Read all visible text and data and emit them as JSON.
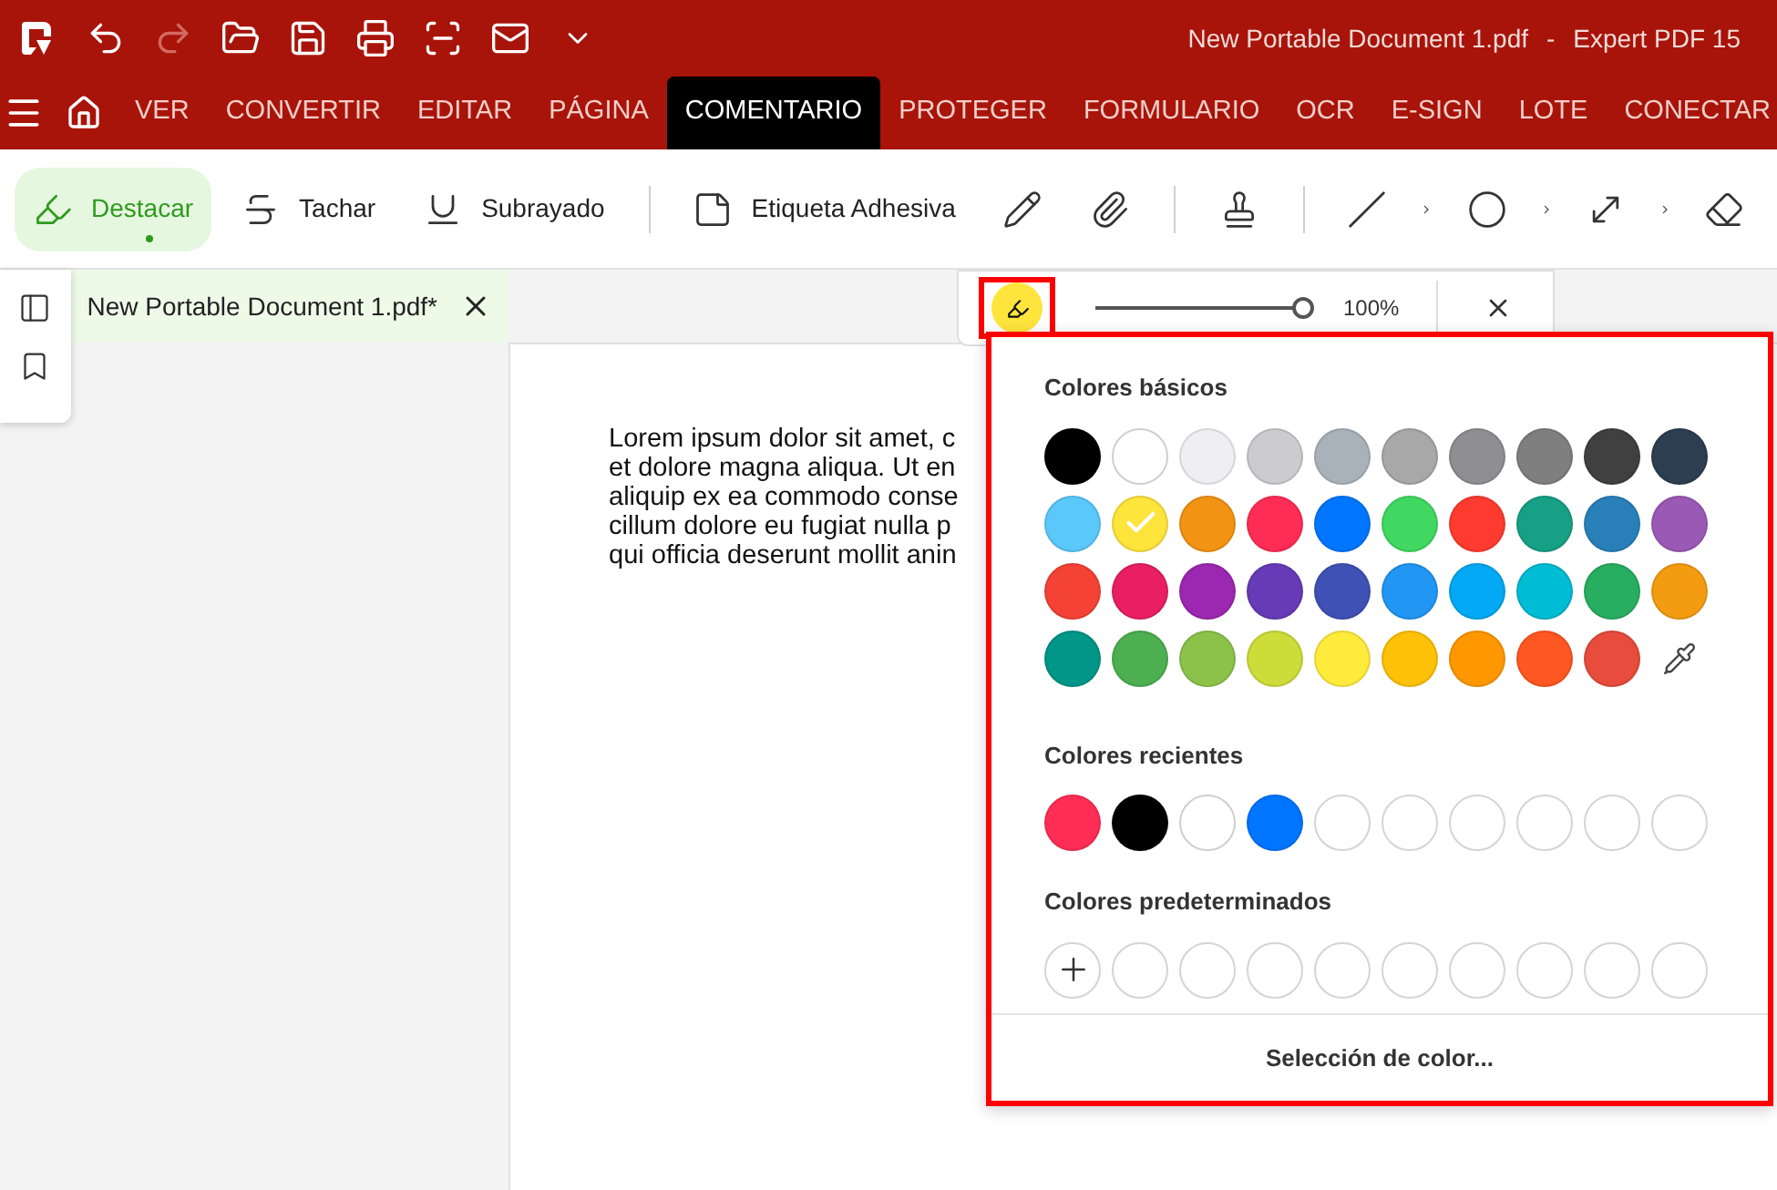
{
  "window": {
    "title": "New Portable Document 1.pdf",
    "separator": "-",
    "app_name": "Expert PDF 15"
  },
  "quick_access": [
    {
      "kind": "undo",
      "disabled": false
    },
    {
      "kind": "redo",
      "disabled": true
    },
    {
      "kind": "open",
      "disabled": false
    },
    {
      "kind": "save",
      "disabled": false
    },
    {
      "kind": "print",
      "disabled": false
    },
    {
      "kind": "scan",
      "disabled": false
    },
    {
      "kind": "mail",
      "disabled": false
    },
    {
      "kind": "more",
      "disabled": false
    }
  ],
  "menu_tabs": [
    {
      "label": "VER",
      "selected": false
    },
    {
      "label": "CONVERTIR",
      "selected": false
    },
    {
      "label": "EDITAR",
      "selected": false
    },
    {
      "label": "PÁGINA",
      "selected": false
    },
    {
      "label": "COMENTARIO",
      "selected": true
    },
    {
      "label": "PROTEGER",
      "selected": false
    },
    {
      "label": "FORMULARIO",
      "selected": false
    },
    {
      "label": "OCR",
      "selected": false
    },
    {
      "label": "E-SIGN",
      "selected": false
    },
    {
      "label": "LOTE",
      "selected": false
    },
    {
      "label": "CONECTAR",
      "selected": false
    }
  ],
  "toolbar": [
    {
      "kind": "highlight",
      "label": "Destacar",
      "selected": true
    },
    {
      "kind": "strike",
      "label": "Tachar",
      "selected": false
    },
    {
      "kind": "underline",
      "label": "Subrayado",
      "selected": false
    },
    {
      "kind": "divider"
    },
    {
      "kind": "note",
      "label": "Etiqueta Adhesiva",
      "selected": false
    },
    {
      "kind": "pencil",
      "selected": false
    },
    {
      "kind": "attach",
      "selected": false
    },
    {
      "kind": "divider"
    },
    {
      "kind": "stamp",
      "selected": false
    },
    {
      "kind": "divider"
    },
    {
      "kind": "line",
      "selected": false
    },
    {
      "kind": "chevron"
    },
    {
      "kind": "ellipse",
      "selected": false
    },
    {
      "kind": "chevron"
    },
    {
      "kind": "measure",
      "selected": false
    },
    {
      "kind": "chevron"
    },
    {
      "kind": "eraser",
      "selected": false
    }
  ],
  "document_tab": {
    "label": "New Portable Document 1.pdf*"
  },
  "document_lines": [
    "Lorem ipsum dolor sit amet, c",
    "et dolore magna aliqua. Ut en",
    "aliquip ex ea commodo conse",
    "cillum dolore eu fugiat nulla p",
    "qui officia deserunt mollit anin"
  ],
  "annotation_bar": {
    "opacity": {
      "level": 1
    },
    "reading": "100%"
  },
  "color_picker": {
    "basic_title": "Colores básicos",
    "basic": [
      [
        {
          "color": "#000000",
          "selected": false
        },
        {
          "color": "#ffffff",
          "selected": false
        },
        {
          "color": "#eeeef3",
          "selected": false
        },
        {
          "color": "#cbcbd0",
          "selected": false
        },
        {
          "color": "#a9b2ba",
          "selected": false
        },
        {
          "color": "#a8a8a8",
          "selected": false
        },
        {
          "color": "#8e8e93",
          "selected": false
        },
        {
          "color": "#7f7f7f",
          "selected": false
        },
        {
          "color": "#404040",
          "selected": false
        },
        {
          "color": "#2c3e50",
          "selected": false
        }
      ],
      [
        {
          "color": "#5ac8fa",
          "selected": false
        },
        {
          "color": "#ffe43b",
          "selected": true
        },
        {
          "color": "#f39313",
          "selected": false
        },
        {
          "color": "#ff2d55",
          "selected": false
        },
        {
          "color": "#0075ff",
          "selected": false
        },
        {
          "color": "#40d860",
          "selected": false
        },
        {
          "color": "#ff3b30",
          "selected": false
        },
        {
          "color": "#16a085",
          "selected": false
        },
        {
          "color": "#2980b9",
          "selected": false
        },
        {
          "color": "#9b59b6",
          "selected": false
        }
      ],
      [
        {
          "color": "#f44336",
          "selected": false
        },
        {
          "color": "#e91e63",
          "selected": false
        },
        {
          "color": "#9c27b0",
          "selected": false
        },
        {
          "color": "#673ab7",
          "selected": false
        },
        {
          "color": "#3f51b5",
          "selected": false
        },
        {
          "color": "#2196f3",
          "selected": false
        },
        {
          "color": "#03a9f4",
          "selected": false
        },
        {
          "color": "#00bcd4",
          "selected": false
        },
        {
          "color": "#27ae60",
          "selected": false
        },
        {
          "color": "#f39c12",
          "selected": false
        }
      ],
      [
        {
          "color": "#009688",
          "selected": false
        },
        {
          "color": "#4caf50",
          "selected": false
        },
        {
          "color": "#8bc34a",
          "selected": false
        },
        {
          "color": "#cddc39",
          "selected": false
        },
        {
          "color": "#ffeb3b",
          "selected": false
        },
        {
          "color": "#ffc107",
          "selected": false
        },
        {
          "color": "#ff9800",
          "selected": false
        },
        {
          "color": "#ff5722",
          "selected": false
        },
        {
          "color": "#e74c3c",
          "selected": false
        }
      ]
    ],
    "recent_title": "Colores recientes",
    "recent": [
      {
        "kind": "color",
        "color": "#ff2d55"
      },
      {
        "kind": "color",
        "color": "#000000"
      },
      {
        "kind": "color",
        "color": "#ffffff"
      },
      {
        "kind": "color",
        "color": "#0075ff"
      },
      {
        "kind": "empty"
      },
      {
        "kind": "empty"
      },
      {
        "kind": "empty"
      },
      {
        "kind": "empty"
      },
      {
        "kind": "empty"
      },
      {
        "kind": "empty"
      }
    ],
    "default_title": "Colores predeterminados",
    "defaults": [
      {
        "kind": "add"
      },
      {
        "kind": "empty"
      },
      {
        "kind": "empty"
      },
      {
        "kind": "empty"
      },
      {
        "kind": "empty"
      },
      {
        "kind": "empty"
      },
      {
        "kind": "empty"
      },
      {
        "kind": "empty"
      },
      {
        "kind": "empty"
      },
      {
        "kind": "empty"
      }
    ],
    "more_button": "Selección de color..."
  }
}
